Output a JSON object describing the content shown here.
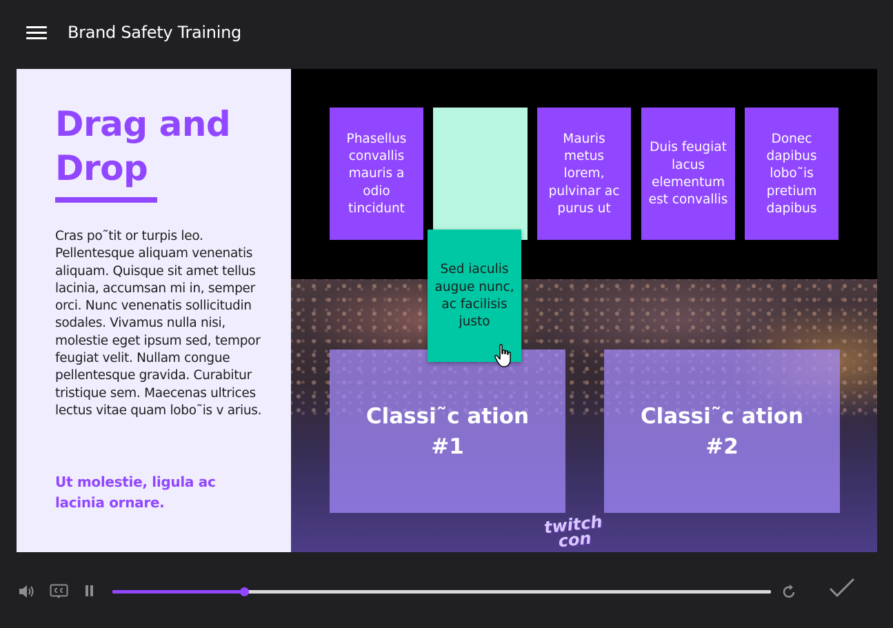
{
  "header": {
    "menu_icon": "hamburger-menu-icon",
    "title": "Brand Safety Training"
  },
  "left_panel": {
    "heading": "Drag and Drop",
    "body": "Cras po˜tit or turpis leo. Pellentesque aliquam venenatis aliquam. Quisque sit amet tellus lacinia, accumsan mi in, semper orci. Nunc venenatis sollicitudin sodales. Vivamus nulla nisi, molestie eget ipsum sed, tempor feugiat velit. Nullam congue pellentesque gravida. Curabitur tristique sem. Maecenas ultrices lectus vitae quam lobo˜is v arius.",
    "callout": "Ut molestie, ligula ac lacinia ornare."
  },
  "cards": [
    {
      "text": "Phasellus convallis mauris a odio tincidunt"
    },
    {
      "text": "Mauris metus lorem, pulvinar ac purus ut"
    },
    {
      "text": "Duis feugiat lacus elementum est convallis"
    },
    {
      "text": "Donec dapibus lobo˜is pretium dapibus"
    }
  ],
  "dragging_card": {
    "text": "Sed iaculis augue nunc, ac facilisis justo"
  },
  "drop_zones": [
    {
      "title": "Classi˜c ation",
      "number": "#1"
    },
    {
      "title": "Classi˜c ation",
      "number": "#2"
    }
  ],
  "background_logo": "twitch con",
  "player": {
    "progress": 0.2,
    "icons": {
      "volume": "speaker-icon",
      "captions": "closed-captions-icon",
      "pause": "pause-icon",
      "replay": "replay-icon",
      "submit": "checkmark-icon"
    }
  },
  "colors": {
    "accent": "#9147ff",
    "panel_bg": "#f0eefe",
    "slot": "#b8f6e1",
    "dragging": "#00c8a5",
    "drop_zone": "#a68cff",
    "app_bg": "#201f22"
  }
}
